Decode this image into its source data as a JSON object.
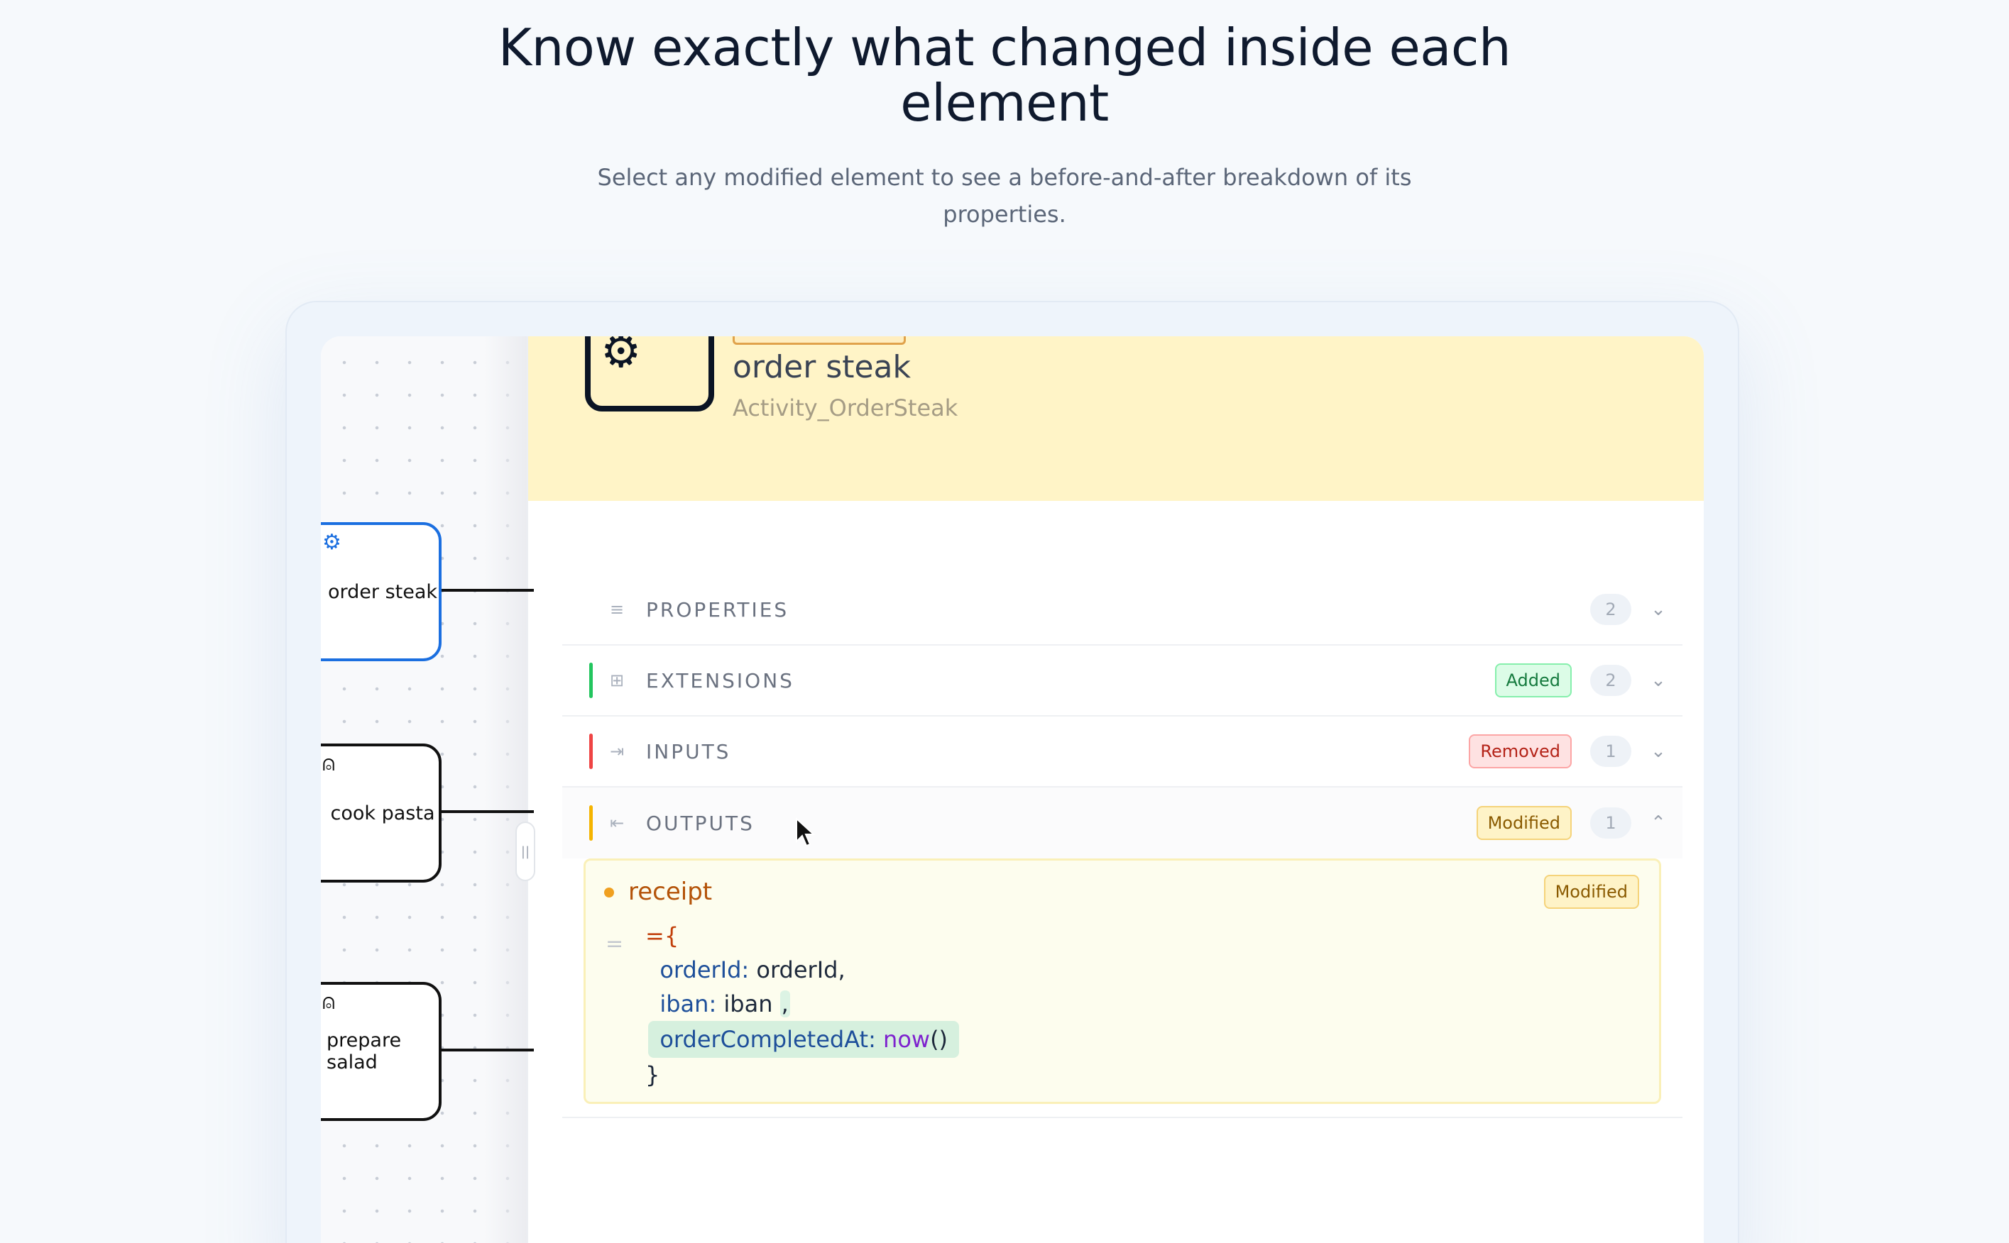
{
  "hero": {
    "title_line1": "Know exactly what changed inside each",
    "title_line2": "element",
    "subtitle_line1": "Select any modified element to see a before-and-after breakdown of its",
    "subtitle_line2": "properties."
  },
  "canvas": {
    "tasks": [
      {
        "label": "order steak",
        "icon": "service-task-icon",
        "selected": true
      },
      {
        "label": "cook pasta",
        "icon": "user-task-icon",
        "selected": false
      },
      {
        "label": "prepare salad",
        "icon": "user-task-icon",
        "selected": false
      }
    ],
    "splitter_glyph": "||"
  },
  "element": {
    "name": "order steak",
    "id": "Activity_OrderSteak",
    "icon": "gear-icon"
  },
  "sections": [
    {
      "label": "PROPERTIES",
      "count": "2",
      "badge": "",
      "status": "none",
      "expanded": false
    },
    {
      "label": "EXTENSIONS",
      "count": "2",
      "badge": "Added",
      "status": "added",
      "expanded": false
    },
    {
      "label": "INPUTS",
      "count": "1",
      "badge": "Removed",
      "status": "removed",
      "expanded": false
    },
    {
      "label": "OUTPUTS",
      "count": "1",
      "badge": "Modified",
      "status": "modified",
      "expanded": true
    }
  ],
  "output_detail": {
    "name": "receipt",
    "badge": "Modified",
    "code": {
      "open": "={",
      "line1_key": "orderId",
      "line1_val": " orderId,",
      "line2_key": "iban",
      "line2_val": " iban",
      "line2_comma": ",",
      "line3_key": "orderCompletedAt",
      "line3_fn": "now",
      "line3_paren": "()",
      "close": "}"
    }
  },
  "colors": {
    "accent_blue": "#1b6fe0",
    "added": "#16a34a",
    "removed": "#dc2626",
    "modified": "#f59e0b",
    "header_bg": "#fff4c7"
  }
}
